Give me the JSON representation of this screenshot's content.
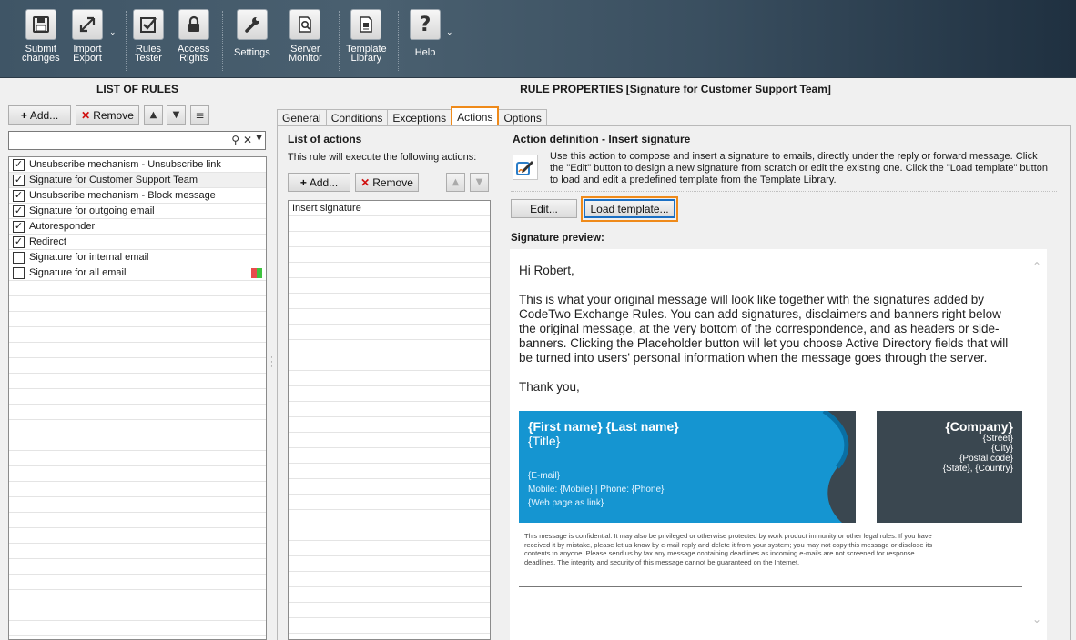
{
  "ribbon": {
    "submit": "Submit\nchanges",
    "import": "Import\nExport",
    "tester": "Rules\nTester",
    "access": "Access\nRights",
    "settings": "Settings",
    "server": "Server\nMonitor",
    "template": "Template\nLibrary",
    "help": "Help"
  },
  "left": {
    "title": "LIST OF RULES",
    "add": "Add...",
    "remove": "Remove",
    "search_value": "",
    "rules": [
      {
        "label": "Unsubscribe mechanism - Unsubscribe link",
        "checked": true
      },
      {
        "label": "Signature for Customer Support Team",
        "checked": true
      },
      {
        "label": "Unsubscribe mechanism - Block message",
        "checked": true
      },
      {
        "label": "Signature for outgoing email",
        "checked": true
      },
      {
        "label": "Autoresponder",
        "checked": true
      },
      {
        "label": "Redirect",
        "checked": true
      },
      {
        "label": "Signature for internal email",
        "checked": false
      },
      {
        "label": "Signature for all email",
        "checked": false
      }
    ]
  },
  "right": {
    "title": "RULE PROPERTIES [Signature for Customer Support Team]",
    "tabs": [
      "General",
      "Conditions",
      "Exceptions",
      "Actions",
      "Options"
    ],
    "active_tab": "Actions",
    "list_title": "List of actions",
    "list_sub": "This rule will execute the following actions:",
    "add": "Add...",
    "remove": "Remove",
    "actions": [
      "Insert signature"
    ],
    "def_title": "Action definition - Insert signature",
    "def_desc": "Use this action to compose and insert a signature to emails, directly under the reply or forward message. Click the \"Edit\" button to design a new signature from scratch or edit the existing one. Click the \"Load template\" button to load and edit a predefined template from the Template Library.",
    "edit": "Edit...",
    "load": "Load template...",
    "preview_label": "Signature preview:"
  },
  "preview": {
    "greeting": "Hi Robert,",
    "body": "This is what your original message will look like together with the signatures added by CodeTwo Exchange Rules. You can add signatures, disclaimers and banners right below the original message, at the very bottom of the correspondence, and as headers or side-banners. Clicking the Placeholder button will let you choose Active Directory fields that will be turned into users' personal information when the message goes through the server.",
    "closing": "Thank you,",
    "name": "{First name} {Last name}",
    "title": "{Title}",
    "email": "{E-mail}",
    "phones": "Mobile:  {Mobile} | Phone: {Phone}",
    "web": "{Web page as link}",
    "company": "{Company}",
    "street": "{Street}",
    "city": "{City}",
    "postal": "{Postal code}",
    "state": "{State}, {Country}",
    "disclaimer": "This message is confidential. It may also be privileged or otherwise protected by work product immunity or other legal rules. If you have received it by mistake, please let us know by e-mail reply and delete it from your system; you may not copy this message or disclose its contents to anyone. Please send us by fax any message containing deadlines as incoming e-mails are not screened for response deadlines. The integrity and security of this message cannot be guaranteed on the Internet."
  },
  "colors": {
    "accent_orange": "#ef8a1a",
    "focus_blue": "#1a6fc4",
    "card_blue": "#1595d1",
    "card_dark": "#3a4750"
  }
}
